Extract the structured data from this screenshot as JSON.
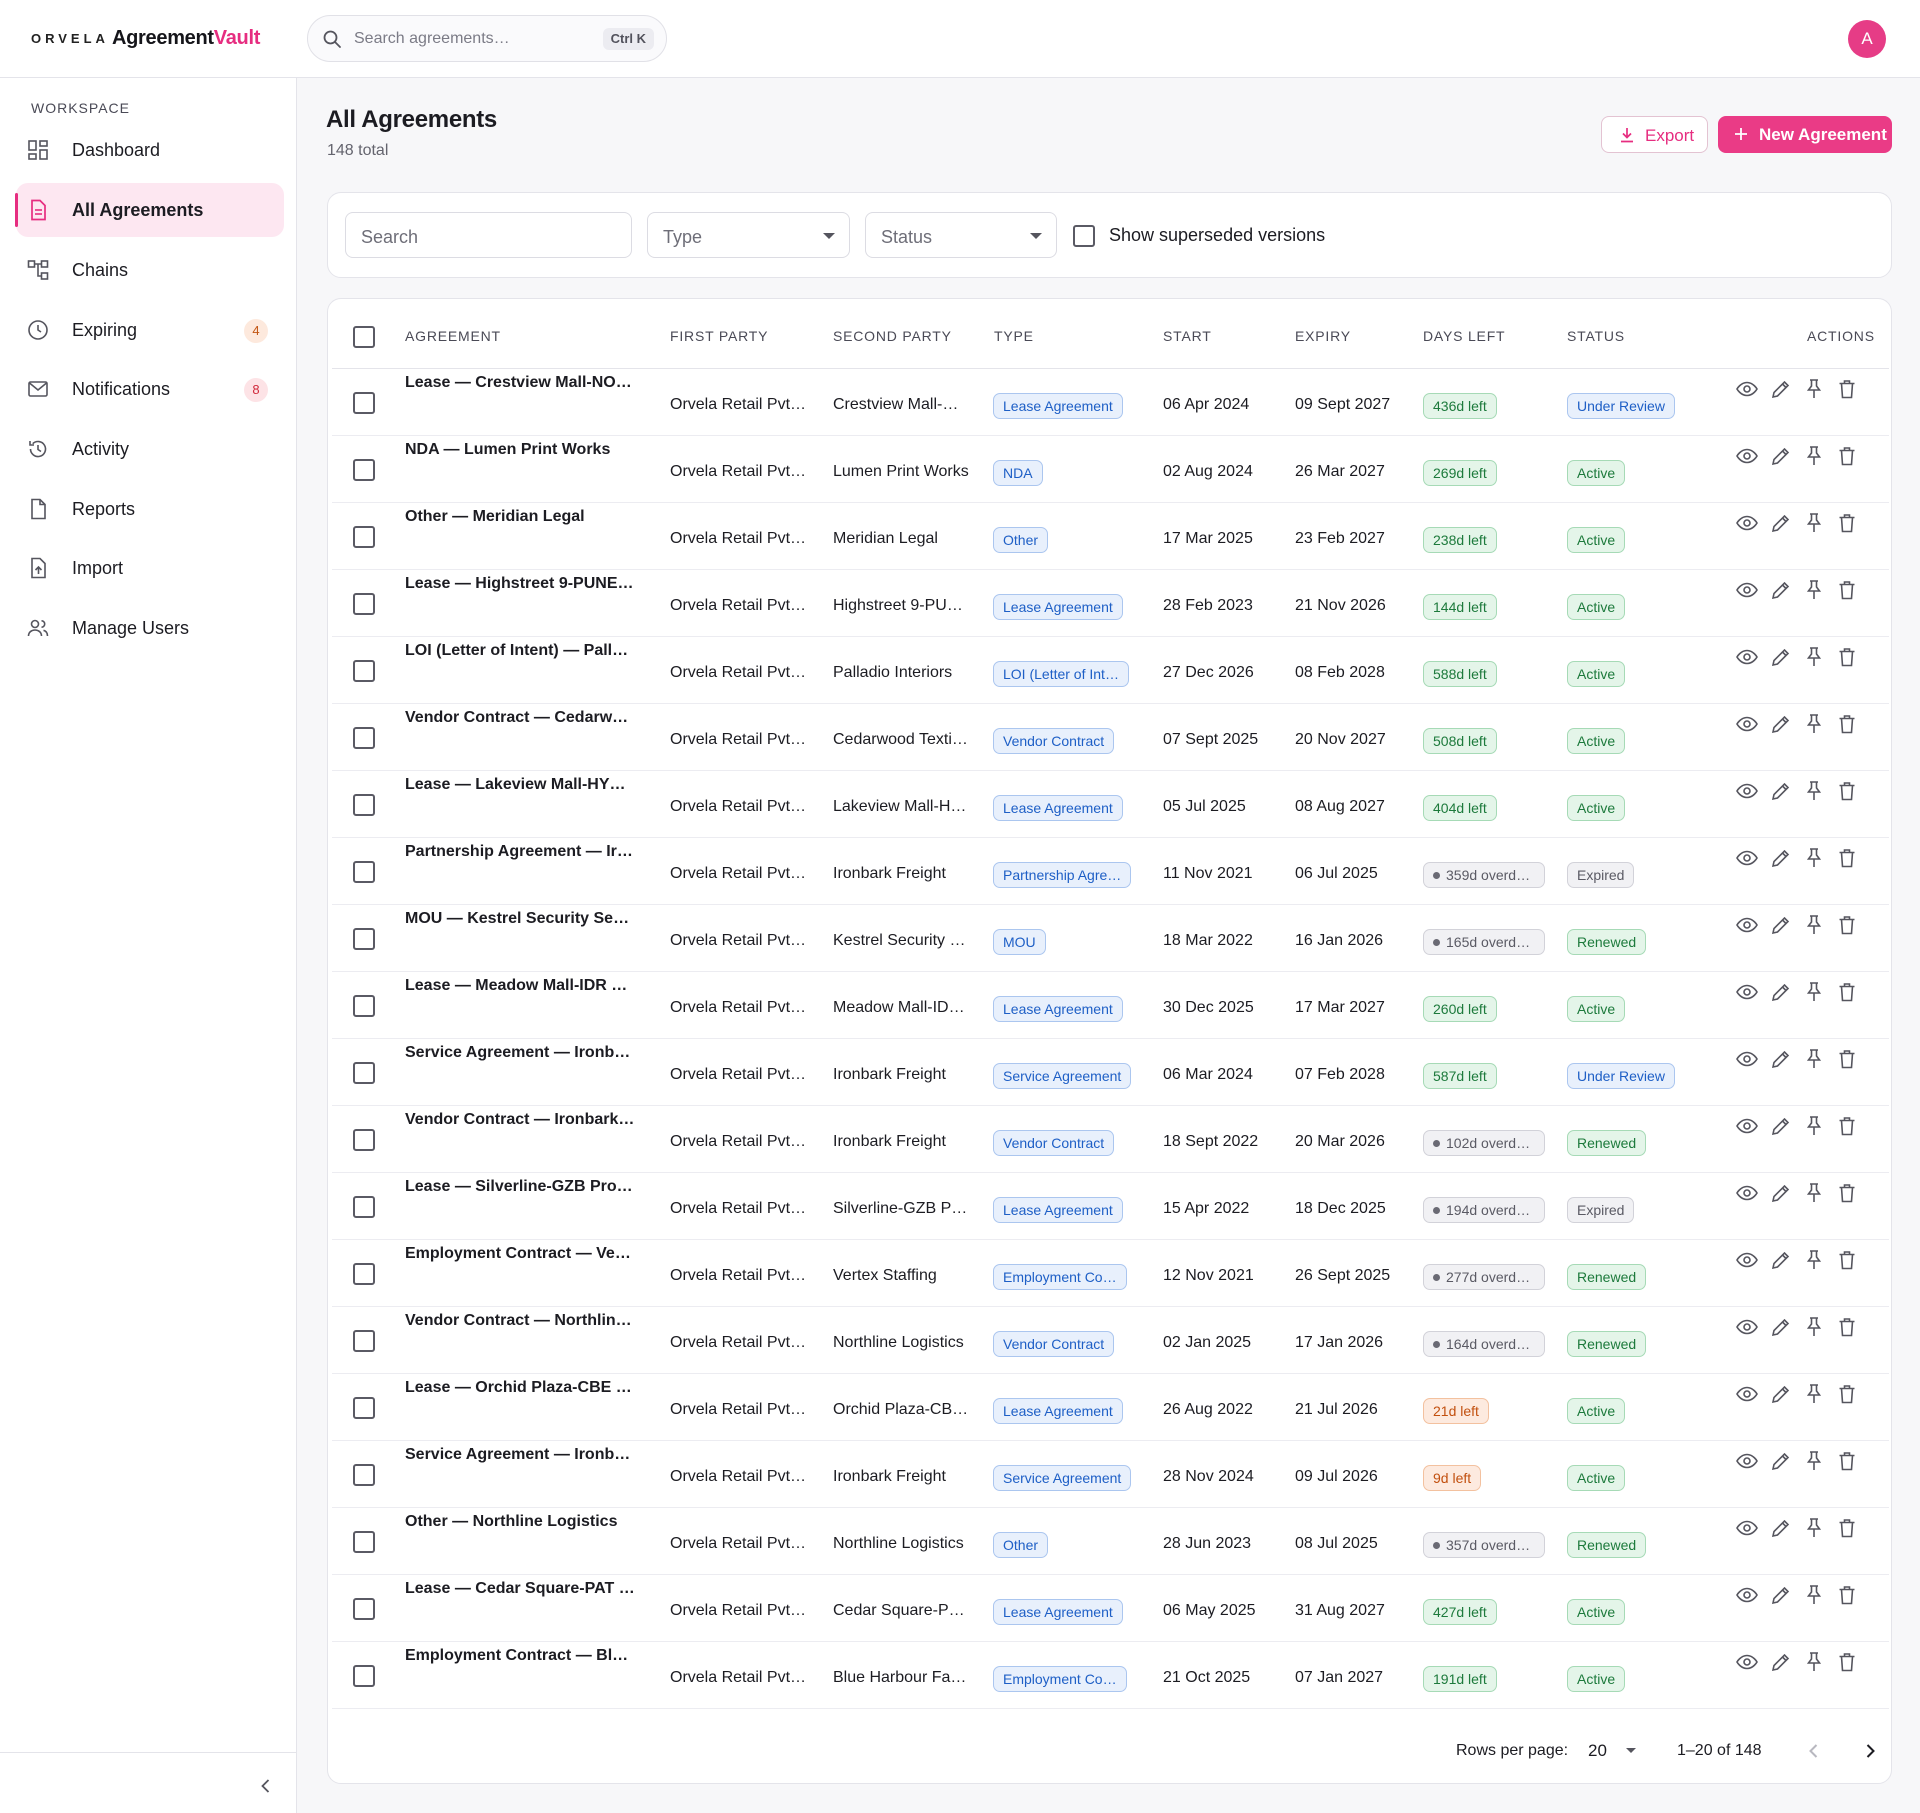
{
  "header": {
    "brand_mark": "ORVELA",
    "brand_name_1": "Agreement",
    "brand_name_2": "Vault",
    "search_placeholder": "Search agreements…",
    "search_shortcut": "Ctrl K",
    "avatar_initial": "A"
  },
  "sidebar": {
    "section_label": "WORKSPACE",
    "items": [
      {
        "label": "Dashboard",
        "icon": "dashboard-icon"
      },
      {
        "label": "All Agreements",
        "icon": "document-icon",
        "active": true
      },
      {
        "label": "Chains",
        "icon": "chains-icon"
      },
      {
        "label": "Expiring",
        "icon": "clock-icon",
        "badge": "4"
      },
      {
        "label": "Notifications",
        "icon": "mail-icon",
        "badge": "8"
      },
      {
        "label": "Activity",
        "icon": "history-icon"
      },
      {
        "label": "Reports",
        "icon": "report-icon"
      },
      {
        "label": "Import",
        "icon": "import-icon"
      },
      {
        "label": "Manage Users",
        "icon": "users-icon"
      }
    ]
  },
  "page": {
    "title": "All Agreements",
    "subtitle": "148 total",
    "export_label": "Export",
    "new_label": "New Agreement"
  },
  "filters": {
    "search_placeholder": "Search",
    "type_placeholder": "Type",
    "status_placeholder": "Status",
    "superseded_label": "Show superseded versions"
  },
  "table": {
    "columns": {
      "agreement": "AGREEMENT",
      "first_party": "FIRST PARTY",
      "second_party": "SECOND PARTY",
      "type": "TYPE",
      "start": "START",
      "expiry": "EXPIRY",
      "days_left": "DAYS LEFT",
      "status": "STATUS",
      "actions": "ACTIONS"
    },
    "rows": [
      {
        "name": "Lease — Crestview Mall-NOI…",
        "first": "Orvela Retail Pvt…",
        "second": "Crestview Mall-…",
        "type": "Lease Agreement",
        "start": "06 Apr 2024",
        "expiry": "09 Sept 2027",
        "days": "436d left",
        "days_kind": "green",
        "status": "Under Review",
        "status_kind": "review"
      },
      {
        "name": "NDA — Lumen Print Works",
        "first": "Orvela Retail Pvt…",
        "second": "Lumen Print Works",
        "type": "NDA",
        "start": "02 Aug 2024",
        "expiry": "26 Mar 2027",
        "days": "269d left",
        "days_kind": "green",
        "status": "Active",
        "status_kind": "active"
      },
      {
        "name": "Other — Meridian Legal",
        "first": "Orvela Retail Pvt…",
        "second": "Meridian Legal",
        "type": "Other",
        "start": "17 Mar 2025",
        "expiry": "23 Feb 2027",
        "days": "238d left",
        "days_kind": "green",
        "status": "Active",
        "status_kind": "active"
      },
      {
        "name": "Lease — Highstreet 9-PUNE …",
        "first": "Orvela Retail Pvt…",
        "second": "Highstreet 9-PU…",
        "type": "Lease Agreement",
        "start": "28 Feb 2023",
        "expiry": "21 Nov 2026",
        "days": "144d left",
        "days_kind": "green",
        "status": "Active",
        "status_kind": "active"
      },
      {
        "name": "LOI (Letter of Intent) — Pallad…",
        "first": "Orvela Retail Pvt…",
        "second": "Palladio Interiors",
        "type": "LOI (Letter of Int…",
        "start": "27 Dec 2026",
        "expiry": "08 Feb 2028",
        "days": "588d left",
        "days_kind": "green",
        "status": "Active",
        "status_kind": "active"
      },
      {
        "name": "Vendor Contract — Cedarwoo…",
        "first": "Orvela Retail Pvt…",
        "second": "Cedarwood Texti…",
        "type": "Vendor Contract",
        "start": "07 Sept 2025",
        "expiry": "20 Nov 2027",
        "days": "508d left",
        "days_kind": "green",
        "status": "Active",
        "status_kind": "active"
      },
      {
        "name": "Lease — Lakeview Mall-HYD …",
        "first": "Orvela Retail Pvt…",
        "second": "Lakeview Mall-H…",
        "type": "Lease Agreement",
        "start": "05 Jul 2025",
        "expiry": "08 Aug 2027",
        "days": "404d left",
        "days_kind": "green",
        "status": "Active",
        "status_kind": "active"
      },
      {
        "name": "Partnership Agreement — Iro…",
        "first": "Orvela Retail Pvt…",
        "second": "Ironbark Freight",
        "type": "Partnership Agre…",
        "start": "11 Nov 2021",
        "expiry": "06 Jul 2025",
        "days": "359d overdue…",
        "days_kind": "grey",
        "status": "Expired",
        "status_kind": "expired"
      },
      {
        "name": "MOU — Kestrel Security Servi…",
        "first": "Orvela Retail Pvt…",
        "second": "Kestrel Security …",
        "type": "MOU",
        "start": "18 Mar 2022",
        "expiry": "16 Jan 2026",
        "days": "165d overdue…",
        "days_kind": "grey",
        "status": "Renewed",
        "status_kind": "renewed"
      },
      {
        "name": "Lease — Meadow Mall-IDR P…",
        "first": "Orvela Retail Pvt…",
        "second": "Meadow Mall-ID…",
        "type": "Lease Agreement",
        "start": "30 Dec 2025",
        "expiry": "17 Mar 2027",
        "days": "260d left",
        "days_kind": "green",
        "status": "Active",
        "status_kind": "active"
      },
      {
        "name": "Service Agreement — Ironbar…",
        "first": "Orvela Retail Pvt…",
        "second": "Ironbark Freight",
        "type": "Service Agreement",
        "start": "06 Mar 2024",
        "expiry": "07 Feb 2028",
        "days": "587d left",
        "days_kind": "green",
        "status": "Under Review",
        "status_kind": "review"
      },
      {
        "name": "Vendor Contract — Ironbark F…",
        "first": "Orvela Retail Pvt…",
        "second": "Ironbark Freight",
        "type": "Vendor Contract",
        "start": "18 Sept 2022",
        "expiry": "20 Mar 2026",
        "days": "102d overdue…",
        "days_kind": "grey",
        "status": "Renewed",
        "status_kind": "renewed"
      },
      {
        "name": "Lease — Silverline-GZB Prop…",
        "first": "Orvela Retail Pvt…",
        "second": "Silverline-GZB P…",
        "type": "Lease Agreement",
        "start": "15 Apr 2022",
        "expiry": "18 Dec 2025",
        "days": "194d overdue…",
        "days_kind": "grey",
        "status": "Expired",
        "status_kind": "expired"
      },
      {
        "name": "Employment Contract — Vert…",
        "first": "Orvela Retail Pvt…",
        "second": "Vertex Staffing",
        "type": "Employment Co…",
        "start": "12 Nov 2021",
        "expiry": "26 Sept 2025",
        "days": "277d overdue…",
        "days_kind": "grey",
        "status": "Renewed",
        "status_kind": "renewed"
      },
      {
        "name": "Vendor Contract — Northline …",
        "first": "Orvela Retail Pvt…",
        "second": "Northline Logistics",
        "type": "Vendor Contract",
        "start": "02 Jan 2025",
        "expiry": "17 Jan 2026",
        "days": "164d overdue…",
        "days_kind": "grey",
        "status": "Renewed",
        "status_kind": "renewed"
      },
      {
        "name": "Lease — Orchid Plaza-CBE P…",
        "first": "Orvela Retail Pvt…",
        "second": "Orchid Plaza-CB…",
        "type": "Lease Agreement",
        "start": "26 Aug 2022",
        "expiry": "21 Jul 2026",
        "days": "21d left",
        "days_kind": "orange",
        "status": "Active",
        "status_kind": "active"
      },
      {
        "name": "Service Agreement — Ironbar…",
        "first": "Orvela Retail Pvt…",
        "second": "Ironbark Freight",
        "type": "Service Agreement",
        "start": "28 Nov 2024",
        "expiry": "09 Jul 2026",
        "days": "9d left",
        "days_kind": "orange",
        "status": "Active",
        "status_kind": "active"
      },
      {
        "name": "Other — Northline Logistics",
        "first": "Orvela Retail Pvt…",
        "second": "Northline Logistics",
        "type": "Other",
        "start": "28 Jun 2023",
        "expiry": "08 Jul 2025",
        "days": "357d overdue…",
        "days_kind": "grey",
        "status": "Renewed",
        "status_kind": "renewed"
      },
      {
        "name": "Lease — Cedar Square-PAT …",
        "first": "Orvela Retail Pvt…",
        "second": "Cedar Square-P…",
        "type": "Lease Agreement",
        "start": "06 May 2025",
        "expiry": "31 Aug 2027",
        "days": "427d left",
        "days_kind": "green",
        "status": "Active",
        "status_kind": "active"
      },
      {
        "name": "Employment Contract — Blue …",
        "first": "Orvela Retail Pvt…",
        "second": "Blue Harbour Fa…",
        "type": "Employment Co…",
        "start": "21 Oct 2025",
        "expiry": "07 Jan 2027",
        "days": "191d left",
        "days_kind": "green",
        "status": "Active",
        "status_kind": "active"
      }
    ]
  },
  "pagination": {
    "rows_label": "Rows per page:",
    "rows_value": "20",
    "range": "1–20 of 148"
  },
  "colors": {
    "accent": "#e62d80",
    "status_blue": "#1e5fc6",
    "status_green": "#1d7a3c",
    "status_orange": "#c2500f"
  }
}
